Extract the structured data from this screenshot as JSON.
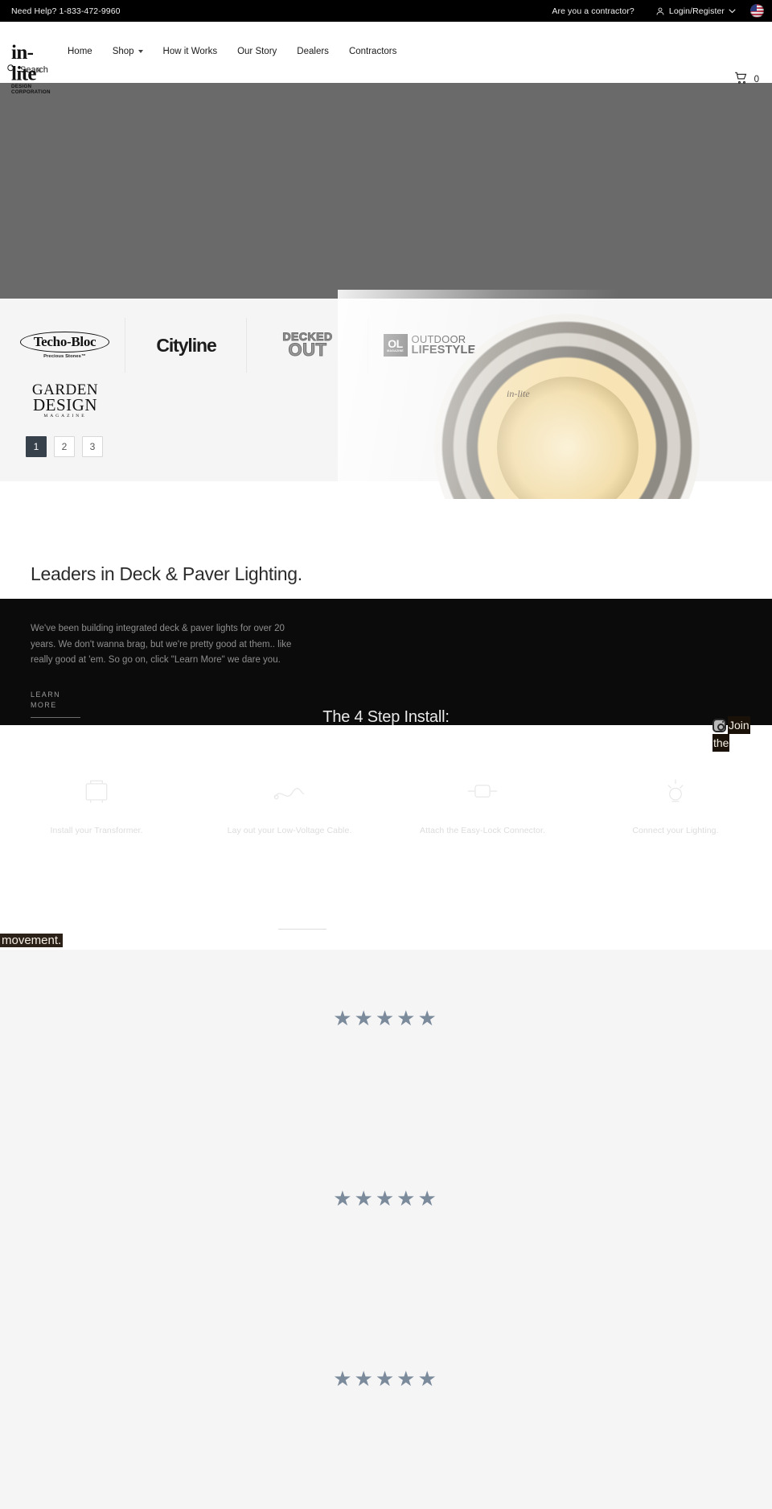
{
  "topbar": {
    "help": "Need Help? 1-833-472-9960",
    "contractor_link": "Are you a contractor?",
    "account_label": "Login/Register",
    "account_icon": "user-icon",
    "caret_icon": "chevron-down-icon",
    "flag_icon": "us-flag-icon"
  },
  "brand": {
    "name": "in-lite",
    "registered": "®",
    "tagline": "DESIGN CORPORATION"
  },
  "nav": {
    "items": [
      {
        "label": "Home",
        "has_dropdown": false
      },
      {
        "label": "Shop",
        "has_dropdown": true
      },
      {
        "label": "How it Works",
        "has_dropdown": false
      },
      {
        "label": "Our Story",
        "has_dropdown": false
      },
      {
        "label": "Dealers",
        "has_dropdown": false
      },
      {
        "label": "Contractors",
        "has_dropdown": false
      }
    ],
    "search_label": "Search",
    "search_icon": "search-icon",
    "cart_icon": "cart-icon",
    "cart_count": "0"
  },
  "press": {
    "logos": [
      {
        "name": "Techo-Bloc",
        "sub": "Precious Stones™"
      },
      {
        "name": "Cityline",
        "sub": ""
      },
      {
        "name": "DECKED OUT",
        "line1": "DECKED",
        "line2": "OUT"
      },
      {
        "name": "OL Magazine Outdoor Lifestyle",
        "mark": "OL",
        "mark_sub": "MAGAZINE",
        "w1": "OUTDOOR",
        "w2": "LIFESTYLE"
      },
      {
        "name": "Garden Design Magazine",
        "g1": "GARDEN",
        "g2": "DESIGN",
        "g3": "MAGAZINE"
      }
    ],
    "pagination": [
      "1",
      "2",
      "3"
    ],
    "active_page": "1"
  },
  "leaders": {
    "heading": "Leaders in Deck & Paver Lighting.",
    "body": "We've been building integrated deck & paver lights for over 20 years. We don't wanna brag, but we're pretty good at them.. like really good at 'em. So go on, click \"Learn More\" we dare you.",
    "cta_line1": "LEARN",
    "cta_line2": "MORE"
  },
  "install": {
    "title": "The 4 Step Install:",
    "steps": [
      {
        "caption": "Install your Transformer.",
        "icon": "transformer-icon"
      },
      {
        "caption": "Lay out your Low-Voltage Cable.",
        "icon": "cable-icon"
      },
      {
        "caption": "Attach the Easy-Lock Connector.",
        "icon": "connector-icon"
      },
      {
        "caption": "Connect your Lighting.",
        "icon": "lamp-icon"
      }
    ]
  },
  "social": {
    "icon": "instagram-icon",
    "line1": "Join",
    "line2": "the",
    "line3": "movement."
  },
  "reviews": [
    {
      "stars": "★★★★★",
      "rating": 5
    },
    {
      "stars": "★★★★★",
      "rating": 5
    },
    {
      "stars": "★★★★★",
      "rating": 5
    }
  ],
  "colors": {
    "topbar_bg": "#000000",
    "dark_panel": "#0b0b0b",
    "hero_placeholder": "#6a6a6a",
    "press_bg": "#f5f5f5",
    "pager_active": "#36414c",
    "star": "#7b8b9c"
  }
}
